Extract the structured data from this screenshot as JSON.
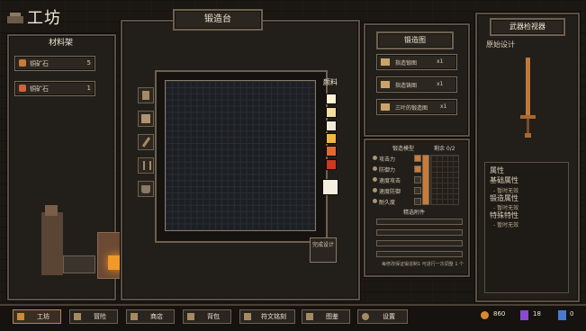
{
  "title": "工坊",
  "shelf": {
    "header": "材料架",
    "items": [
      {
        "label": "铜矿石",
        "count": "5",
        "icon_color": "#c97b3a"
      },
      {
        "label": "铜矿石",
        "count": "1",
        "icon_color": "#d0643a"
      }
    ]
  },
  "forge": {
    "header": "锻造台",
    "paint_label": "颜料",
    "swatches": [
      "#fff3d6",
      "#f4dea0",
      "#f1e9d8",
      "#f0b642",
      "#e06a30",
      "#cc3a23",
      "#f5efe0"
    ],
    "complete_label": "完成设计",
    "tools": [
      "hammer-icon",
      "mallet-icon",
      "chisel-icon",
      "tongs-icon",
      "bucket-icon"
    ]
  },
  "blueprints": {
    "header": "锻造图",
    "items": [
      {
        "name": "指造锻图",
        "qty": "x1"
      },
      {
        "name": "指造铸图",
        "qty": "x1"
      },
      {
        "name": "三叶的锻造图",
        "qty": "x1"
      }
    ]
  },
  "stats": {
    "header": "锻造模型",
    "slots": "剩余 0/2",
    "rows": [
      "攻击力",
      "防御力",
      "速度攻击",
      "速度防御",
      "耐久度"
    ],
    "refine_label": "精选附件",
    "footer": "每修改保证锻造制1 可进行一次调整 1 个"
  },
  "inspector": {
    "header": "武器检视器",
    "design_label": "原始设计",
    "attrs_title": "属性",
    "base_attr": "基础属性",
    "base_sub": "- 暂时无效",
    "forge_attr": "锻造属性",
    "forge_sub": "- 暂时无效",
    "special_attr": "特殊特性",
    "special_sub": "- 暂时无效"
  },
  "nav": [
    {
      "label": "工坊",
      "icon": "anvil-icon"
    },
    {
      "label": "冒险",
      "icon": "map-icon"
    },
    {
      "label": "商店",
      "icon": "shop-icon"
    },
    {
      "label": "背包",
      "icon": "bag-icon"
    },
    {
      "label": "符文铭刻",
      "icon": "rune-icon"
    },
    {
      "label": "图鉴",
      "icon": "book-icon"
    },
    {
      "label": "设置",
      "icon": "gear-icon"
    }
  ],
  "currency": {
    "gold": "860",
    "purple": "18",
    "blue": "0"
  }
}
